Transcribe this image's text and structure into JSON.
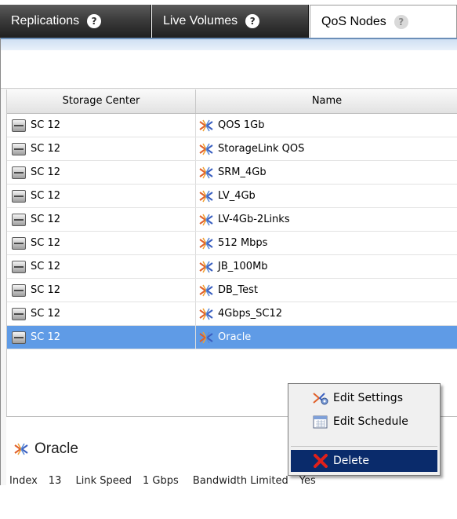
{
  "tabs": [
    {
      "label": "Replications",
      "help": "?"
    },
    {
      "label": "Live Volumes",
      "help": "?"
    },
    {
      "label": "QoS Nodes",
      "help": "?"
    }
  ],
  "table": {
    "columns": [
      "Storage Center",
      "Name"
    ],
    "rows": [
      {
        "storage_center": "SC 12",
        "name": "QOS 1Gb"
      },
      {
        "storage_center": "SC 12",
        "name": "StorageLink QOS"
      },
      {
        "storage_center": "SC 12",
        "name": "SRM_4Gb"
      },
      {
        "storage_center": "SC 12",
        "name": "LV_4Gb"
      },
      {
        "storage_center": "SC 12",
        "name": "LV-4Gb-2Links"
      },
      {
        "storage_center": "SC 12",
        "name": "512 Mbps"
      },
      {
        "storage_center": "SC 12",
        "name": "JB_100Mb"
      },
      {
        "storage_center": "SC 12",
        "name": "DB_Test"
      },
      {
        "storage_center": "SC 12",
        "name": "4Gbps_SC12"
      },
      {
        "storage_center": "SC 12",
        "name": "Oracle"
      }
    ],
    "selected_row": 9
  },
  "detail": {
    "title": "Oracle",
    "index_label": "Index",
    "index_value": "13",
    "link_speed_label": "Link Speed",
    "link_speed_value": "1 Gbps",
    "bandwidth_label": "Bandwidth Limited",
    "bandwidth_value": "Yes"
  },
  "context_menu": {
    "items": [
      {
        "label": "Edit Settings",
        "icon": "settings-gear-icon"
      },
      {
        "label": "Edit Schedule",
        "icon": "calendar-icon"
      },
      {
        "label": "Delete",
        "icon": "delete-x-icon",
        "highlighted": true
      }
    ]
  },
  "colors": {
    "selection": "#5f9be6",
    "menu_highlight": "#0a2b6b",
    "tab_dark": "#2a2a2a"
  }
}
